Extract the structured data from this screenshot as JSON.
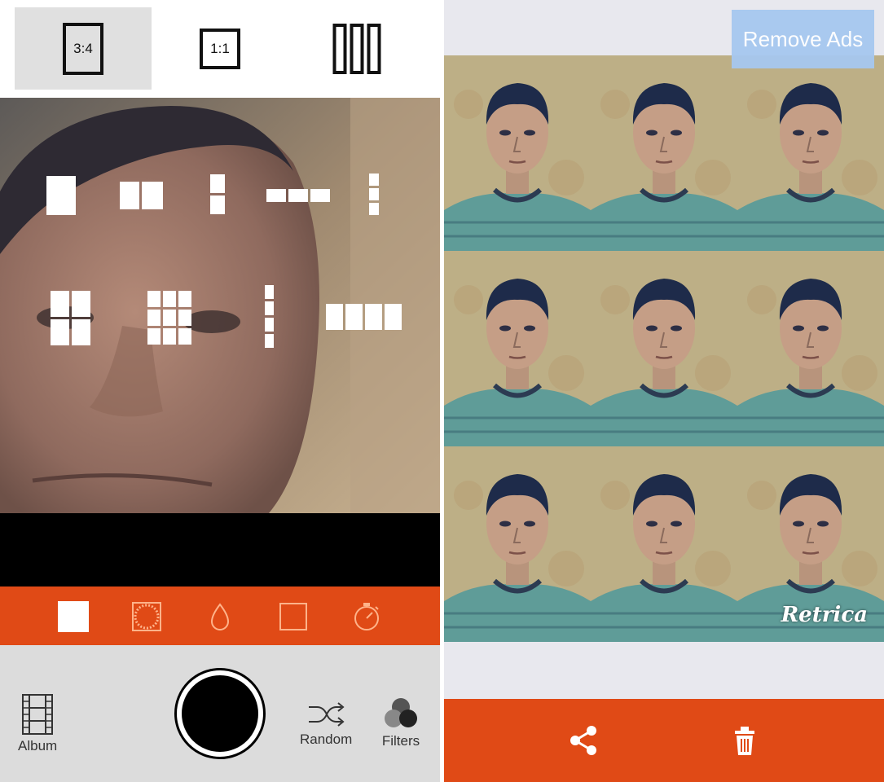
{
  "left_panel": {
    "ratio_options": [
      {
        "label": "3:4",
        "selected": true
      },
      {
        "label": "1:1",
        "selected": false
      },
      {
        "label": "",
        "selected": false
      }
    ],
    "modes": [
      {
        "icon": "square-fill-icon"
      },
      {
        "icon": "circle-vignette-icon"
      },
      {
        "icon": "drop-blur-icon"
      },
      {
        "icon": "square-outline-icon"
      },
      {
        "icon": "timer-icon"
      }
    ],
    "bottom": {
      "album_label": "Album",
      "random_label": "Random",
      "filters_label": "Filters"
    }
  },
  "right_panel": {
    "remove_ads_label": "Remove Ads",
    "watermark": "Retrica"
  },
  "colors": {
    "accent": "#e04a16",
    "bottom_bar": "#dcdcdc",
    "remove_ads_bg": "#a6c8f0"
  }
}
